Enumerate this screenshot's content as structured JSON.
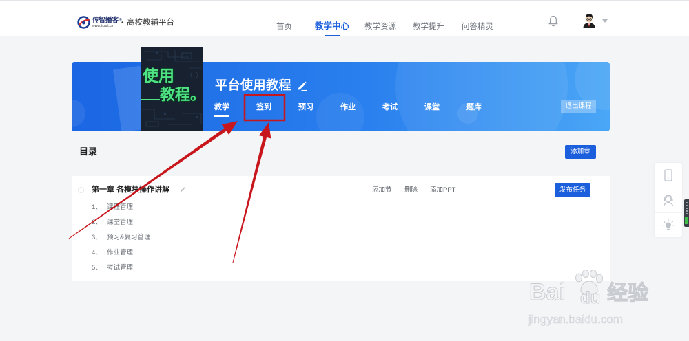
{
  "header": {
    "logo": {
      "brand": "传智播客",
      "reg_mark": "®",
      "site": "www.itcast.cn",
      "separator": "•",
      "platform": "高校教辅平台"
    },
    "nav": [
      {
        "label": "首页",
        "active": false
      },
      {
        "label": "教学中心",
        "active": true
      },
      {
        "label": "教学资源",
        "active": false
      },
      {
        "label": "教学提升",
        "active": false
      },
      {
        "label": "问答精灵",
        "active": false
      }
    ],
    "icons": {
      "notifications": "bell-icon",
      "user": "avatar-icon",
      "user_menu": "chevron-down-icon"
    }
  },
  "course": {
    "cover": {
      "line1": "使用",
      "line2": "教程。"
    },
    "title": "平台使用教程",
    "title_icon": "pencil-icon",
    "tabs": [
      {
        "label": "教学",
        "active": true,
        "annotated": false
      },
      {
        "label": "签到",
        "active": false,
        "annotated": true
      },
      {
        "label": "预习",
        "active": false,
        "annotated": false
      },
      {
        "label": "作业",
        "active": false,
        "annotated": false
      },
      {
        "label": "考试",
        "active": false,
        "annotated": false
      },
      {
        "label": "课堂",
        "active": false,
        "annotated": false
      },
      {
        "label": "题库",
        "active": false,
        "annotated": false
      }
    ],
    "exit_label": "退出课程"
  },
  "catalog": {
    "heading": "目录",
    "add_chapter_label": "添加章",
    "chapters": [
      {
        "title": "第一章 各模块操作讲解",
        "actions": [
          "添加节",
          "删除",
          "添加PPT"
        ],
        "publish_label": "发布任务",
        "sections": [
          {
            "index": "1、",
            "title": "课程管理"
          },
          {
            "index": "2、",
            "title": "课堂管理"
          },
          {
            "index": "3、",
            "title": "预习&复习管理"
          },
          {
            "index": "4、",
            "title": "作业管理"
          },
          {
            "index": "5、",
            "title": "考试管理"
          }
        ]
      }
    ]
  },
  "side_tools": [
    {
      "icon": "mobile-phone-icon"
    },
    {
      "icon": "customer-service-icon"
    },
    {
      "icon": "lightbulb-icon"
    }
  ],
  "watermark": {
    "brand_left": "Bai",
    "brand_right": "du",
    "product": "经验",
    "url": "jingyan.baidu.com"
  },
  "colors": {
    "accent": "#1c5fdc",
    "banner_start": "#1b66e3",
    "banner_end": "#4aa6f6",
    "annotation": "#c8161d",
    "cover_text": "#4fe384"
  }
}
